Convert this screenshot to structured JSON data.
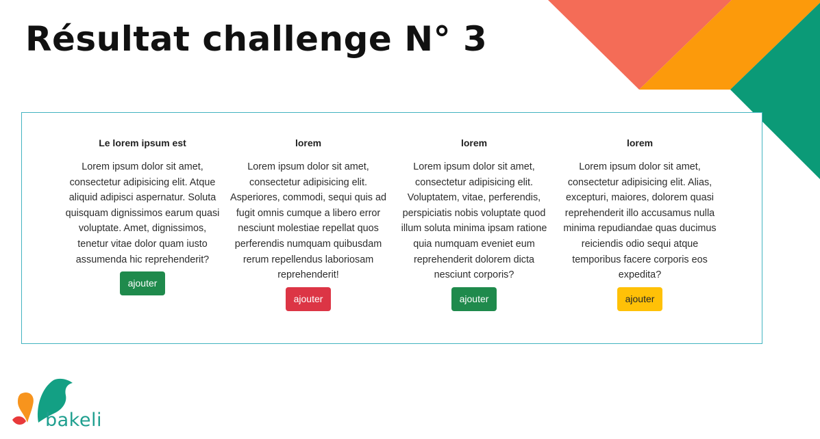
{
  "page": {
    "title": "Résultat challenge N° 3"
  },
  "brand": {
    "name": "bakeli",
    "colors": {
      "coral": "#f46c57",
      "orange": "#fc9a0b",
      "green": "#0b9a77",
      "teal_text": "#1f9f8f"
    }
  },
  "panel": {
    "border_color": "#41b3c0",
    "cards": [
      {
        "title": "Le lorem ipsum est",
        "text": "Lorem ipsum dolor sit amet, consectetur adipisicing elit. Atque aliquid adipisci aspernatur. Soluta quisquam dignissimos earum quasi voluptate. Amet, dignissimos, tenetur vitae dolor quam iusto assumenda hic reprehenderit?",
        "button": {
          "label": "ajouter",
          "bg": "#1f8a4c",
          "fg": "#ffffff"
        }
      },
      {
        "title": "lorem",
        "text": "Lorem ipsum dolor sit amet, consectetur adipisicing elit. Asperiores, commodi, sequi quis ad fugit omnis cumque a libero error nesciunt molestiae repellat quos perferendis numquam quibusdam rerum repellendus laboriosam reprehenderit!",
        "button": {
          "label": "ajouter",
          "bg": "#dc3545",
          "fg": "#ffffff"
        }
      },
      {
        "title": "lorem",
        "text": "Lorem ipsum dolor sit amet, consectetur adipisicing elit. Voluptatem, vitae, perferendis, perspiciatis nobis voluptate quod illum soluta minima ipsam ratione quia numquam eveniet eum reprehenderit dolorem dicta nesciunt corporis?",
        "button": {
          "label": "ajouter",
          "bg": "#1f8a4c",
          "fg": "#ffffff"
        }
      },
      {
        "title": "lorem",
        "text": "Lorem ipsum dolor sit amet, consectetur adipisicing elit. Alias, excepturi, maiores, dolorem quasi reprehenderit illo accusamus nulla minima repudiandae quas ducimus reiciendis odio sequi atque temporibus facere corporis eos expedita?",
        "button": {
          "label": "ajouter",
          "bg": "#ffc107",
          "fg": "#212529"
        }
      }
    ]
  }
}
